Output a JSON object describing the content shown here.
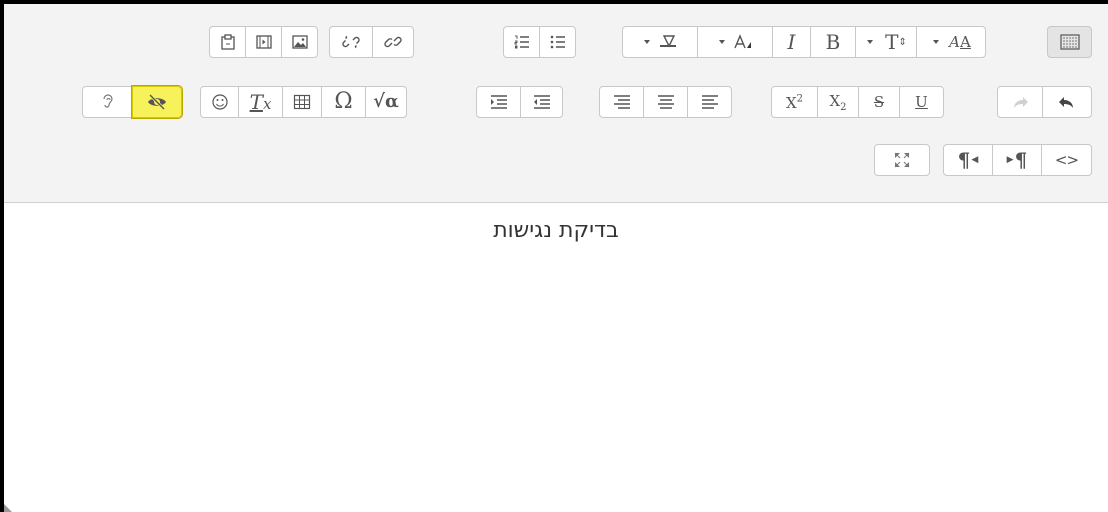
{
  "editor": {
    "content_text": "בדיקת נגישות"
  },
  "toolbar": {
    "row1_icons": [
      "paste-icon",
      "media-icon",
      "image-icon",
      "unlink-icon",
      "link-icon",
      "numbered-list-icon",
      "bullet-list-icon",
      "background-color-icon",
      "text-color-icon",
      "italic-icon",
      "bold-icon",
      "font-size-icon",
      "font-family-icon",
      "toolbar-toggle-icon"
    ],
    "row2_icons": [
      "screenreader-helper-icon",
      "accessibility-checker-icon",
      "emoticon-icon",
      "clear-formatting-icon",
      "table-icon",
      "special-character-icon",
      "equation-icon",
      "indent-icon",
      "outdent-icon",
      "align-right-icon",
      "align-center-icon",
      "align-left-icon",
      "superscript-icon",
      "subscript-icon",
      "strikethrough-icon",
      "underline-icon",
      "redo-icon",
      "undo-icon"
    ],
    "row3_icons": [
      "fullscreen-icon",
      "ltr-icon",
      "rtl-icon",
      "html-source-icon"
    ],
    "glyphs": {
      "italic": "I",
      "bold": "B",
      "omega": "Ω",
      "sqrt_alpha": "√α",
      "super_base": "X",
      "super_exp": "2",
      "sub_base": "X",
      "sub_idx": "2",
      "strike": "S",
      "underline": "U",
      "clear_T": "T",
      "clear_x": "x",
      "pilcrow": "¶",
      "ltr_pilcrow": "¶",
      "source": "<>",
      "fontsize_T": "T",
      "fontfamily_A": "A"
    },
    "active_button": "accessibility-checker-button",
    "highlight_color": "#f7f25a"
  }
}
